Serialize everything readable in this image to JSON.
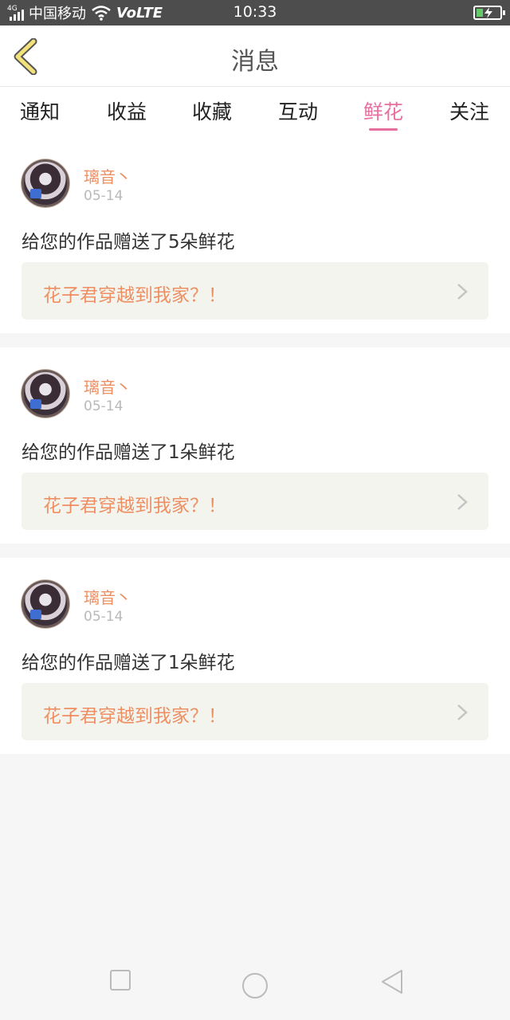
{
  "status_bar": {
    "network_small": "4G",
    "carrier": "中国移动",
    "volte": "VoLTE",
    "time": "10:33",
    "battery_level": 0.3
  },
  "header": {
    "title": "消息",
    "back_icon": "chevron-left-icon"
  },
  "tabs": [
    {
      "label": "通知",
      "active": false
    },
    {
      "label": "收益",
      "active": false
    },
    {
      "label": "收藏",
      "active": false
    },
    {
      "label": "互动",
      "active": false
    },
    {
      "label": "鲜花",
      "active": true
    },
    {
      "label": "关注",
      "active": false
    }
  ],
  "accent_color": "#e86fa0",
  "name_color": "#ee8f63",
  "messages": [
    {
      "user": "璃音丶",
      "date": "05-14",
      "text": "给您的作品赠送了5朵鲜花",
      "work_title": "花子君穿越到我家？！"
    },
    {
      "user": "璃音丶",
      "date": "05-14",
      "text": "给您的作品赠送了1朵鲜花",
      "work_title": "花子君穿越到我家？！"
    },
    {
      "user": "璃音丶",
      "date": "05-14",
      "text": "给您的作品赠送了1朵鲜花",
      "work_title": "花子君穿越到我家？！"
    }
  ],
  "nav_bar": {
    "icons": [
      "square-icon",
      "circle-icon",
      "triangle-back-icon"
    ]
  }
}
